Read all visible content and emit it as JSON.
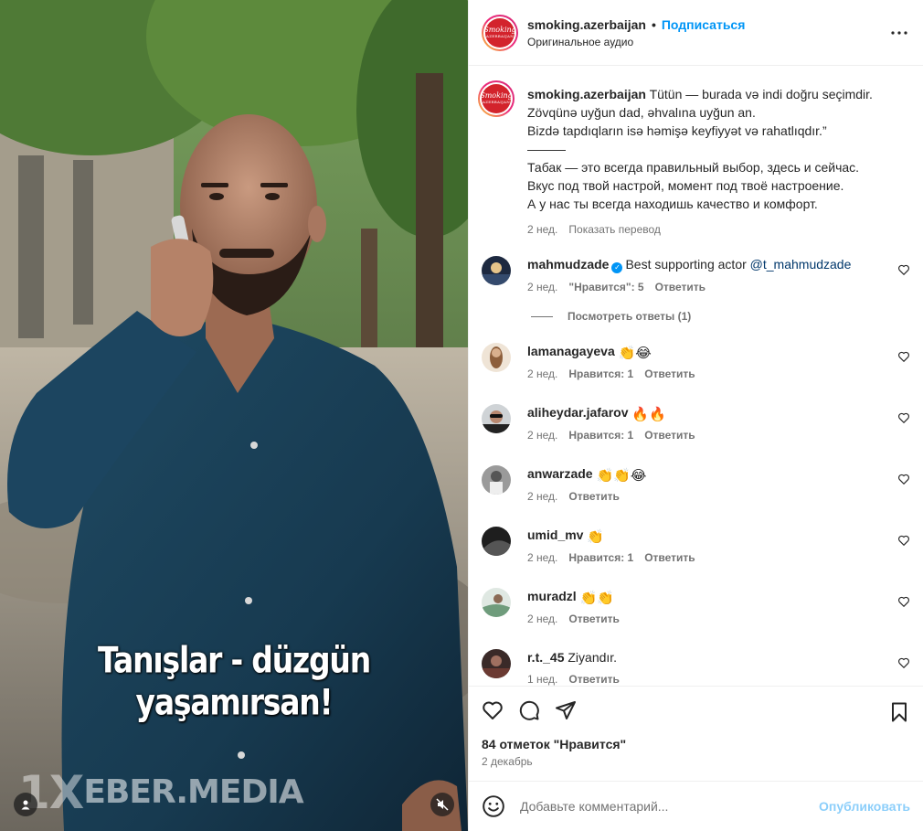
{
  "post": {
    "username": "smoking.azerbaijan",
    "follow_label": "Подписаться",
    "audio_label": "Оригинальное аудио",
    "more_icon": "more-horizontal-icon",
    "logo_text": "Smoking",
    "logo_subtext": "AZERBAIJAN"
  },
  "media": {
    "subtitle": "Tanışlar - düzgün yaşamırsan!",
    "watermark_prefix": "1X",
    "watermark_text": "EBER.MEDIA",
    "user_icon": "user-tag-icon",
    "mute_icon": "volume-muted-icon"
  },
  "caption": {
    "username": "smoking.azerbaijan",
    "lines": [
      "Tütün — burada və indi doğru seçimdir.",
      "Zövqünə uyğun dad, əhvalına uyğun an.",
      "Bizdə tapdıqların isə həmişə keyfiyyət və rahatlıqdır.”",
      "———",
      "Табак — это всегда правильный выбор, здесь и сейчас.",
      "Вкус под твой настрой, момент под твоё настроение.",
      "А у нас ты всегда находишь качество и комфорт."
    ],
    "time": "2 нед.",
    "translate": "Показать перевод"
  },
  "comments": [
    {
      "user": "mahmudzade",
      "verified": true,
      "text": "Best supporting actor ",
      "mention": "@t_mahmudzade",
      "time": "2 нед.",
      "likes": "\"Нравится\": 5",
      "reply": "Ответить",
      "view_replies": "Посмотреть ответы (1)",
      "avatar_color": "#2d3b55"
    },
    {
      "user": "lamanagayeva",
      "text": "👏😂",
      "time": "2 нед.",
      "likes": "Нравится: 1",
      "reply": "Ответить",
      "avatar_color": "#c79a6a"
    },
    {
      "user": "aliheydar.jafarov",
      "text": "🔥🔥",
      "time": "2 нед.",
      "likes": "Нравится: 1",
      "reply": "Ответить",
      "avatar_color": "#3a3a3a"
    },
    {
      "user": "anwarzade",
      "text": "👏👏😂",
      "time": "2 нед.",
      "likes": "",
      "reply": "Ответить",
      "avatar_color": "#8a8a8a"
    },
    {
      "user": "umid_mv",
      "text": "👏",
      "time": "2 нед.",
      "likes": "Нравится: 1",
      "reply": "Ответить",
      "avatar_color": "#2a2a2a"
    },
    {
      "user": "muradzl",
      "text": "👏👏",
      "time": "2 нед.",
      "likes": "",
      "reply": "Ответить",
      "avatar_color": "#7d9a8c"
    },
    {
      "user": "r.t._45",
      "text": "Ziyandır.",
      "time": "1 нед.",
      "likes": "",
      "reply": "Ответить",
      "avatar_color": "#5a3a36"
    }
  ],
  "actions": {
    "like_icon": "heart-icon",
    "comment_icon": "comment-icon",
    "share_icon": "share-icon",
    "save_icon": "bookmark-icon",
    "likes_text": "84 отметок \"Нравится\"",
    "date": "2 декабрь"
  },
  "add_comment": {
    "emoji_icon": "emoji-icon",
    "placeholder": "Добавьте комментарий...",
    "publish": "Опубликовать"
  }
}
